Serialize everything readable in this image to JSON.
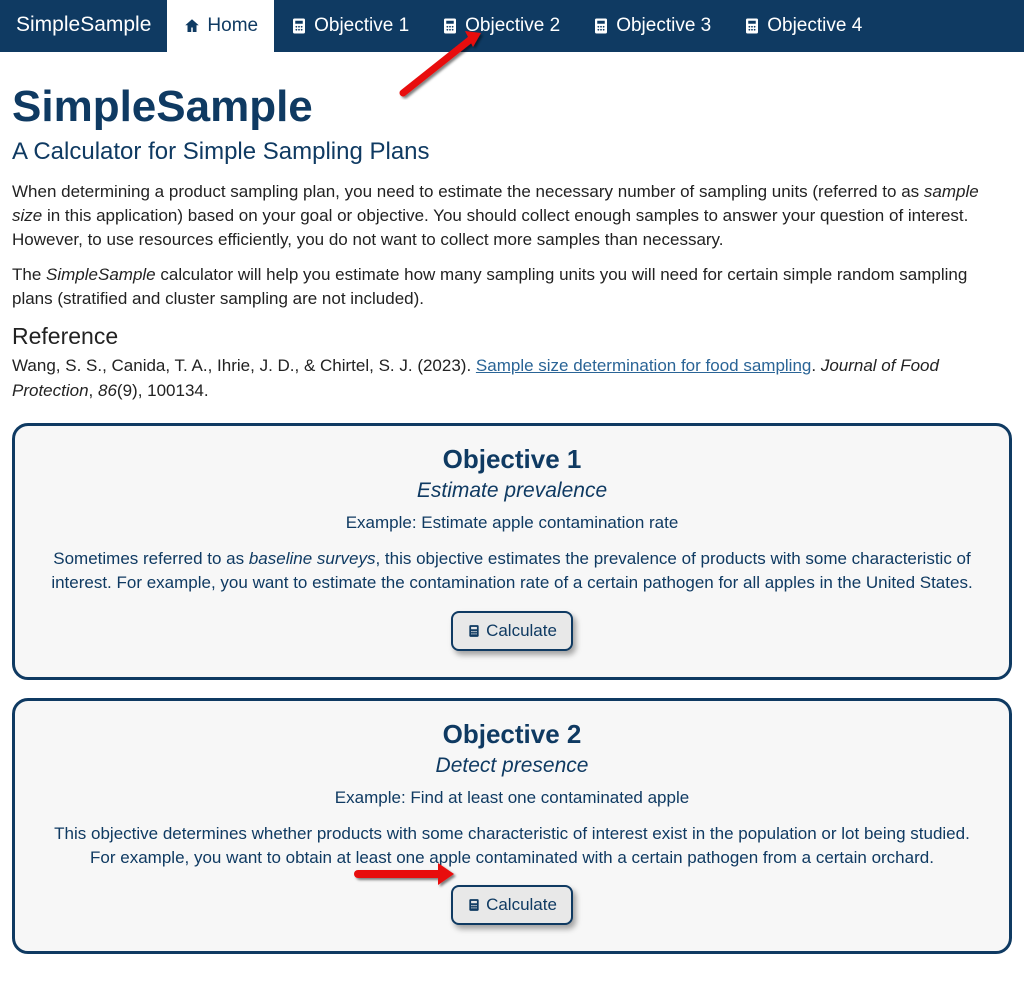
{
  "nav": {
    "brand": "SimpleSample",
    "items": [
      {
        "label": "Home",
        "icon": "home",
        "active": true
      },
      {
        "label": "Objective 1",
        "icon": "calc",
        "active": false
      },
      {
        "label": "Objective 2",
        "icon": "calc",
        "active": false
      },
      {
        "label": "Objective 3",
        "icon": "calc",
        "active": false
      },
      {
        "label": "Objective 4",
        "icon": "calc",
        "active": false
      }
    ]
  },
  "page": {
    "title": "SimpleSample",
    "subtitle": "A Calculator for Simple Sampling Plans",
    "p1_a": "When determining a product sampling plan, you need to estimate the necessary number of sampling units (referred to as ",
    "p1_em": "sample size",
    "p1_b": " in this application) based on your goal or objective. You should collect enough samples to answer your question of interest. However, to use resources efficiently, you do not want to collect more samples than necessary.",
    "p2_a": "The ",
    "p2_em": "SimpleSample",
    "p2_b": " calculator will help you estimate how many sampling units you will need for certain simple random sampling plans (stratified and cluster sampling are not included).",
    "ref_head": "Reference",
    "ref_authors": "Wang, S. S., Canida, T. A., Ihrie, J. D., & Chirtel, S. J. (2023). ",
    "ref_link": "Sample size determination for food sampling",
    "ref_tail_a": ". ",
    "ref_journal": "Journal of Food Protection",
    "ref_tail_b": ", ",
    "ref_vol": "86",
    "ref_tail_c": "(9), 100134."
  },
  "cards": [
    {
      "heading": "Objective 1",
      "subtitle": "Estimate prevalence",
      "example": "Example: Estimate apple contamination rate",
      "body_a": "Sometimes referred to as ",
      "body_em": "baseline surveys",
      "body_b": ", this objective estimates the prevalence of products with some characteristic of interest. For example, you want to estimate the contamination rate of a certain pathogen for all apples in the United States.",
      "button": "Calculate"
    },
    {
      "heading": "Objective 2",
      "subtitle": "Detect presence",
      "example": "Example: Find at least one contaminated apple",
      "body_a": "",
      "body_em": "",
      "body_b": "This objective determines whether products with some characteristic of interest exist in the population or lot being studied. For example, you want to obtain at least one apple contaminated with a certain pathogen from a certain orchard.",
      "button": "Calculate"
    }
  ]
}
